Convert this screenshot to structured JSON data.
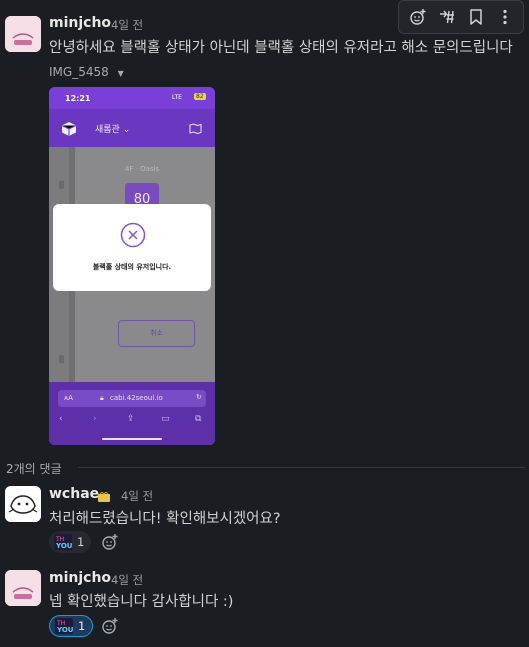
{
  "toolbar": {
    "icons": [
      "add-reaction-icon",
      "reply-in-thread-icon",
      "bookmark-icon",
      "more-actions-icon"
    ]
  },
  "message1": {
    "author": "minjcho",
    "time": "4일 전",
    "text": "안녕하세요 블랙홀 상태가 아닌데 블랙홀 상태의 유저라고 해소 문의드립니다",
    "attachment": {
      "filename": "IMG_5458",
      "phone_status_time": "12:21",
      "phone_status_net": "LTE",
      "phone_status_battery": "82",
      "campus_selector": "새롬관",
      "floor_label": "4F · Oasis",
      "seat_number": "80",
      "dialog_text": "블랙홀 상태의 유저입니다.",
      "cancel_button": "취소",
      "url_aa": "ᴀA",
      "url": "cabi.42seoul.io"
    }
  },
  "thread": {
    "replies_label": "2개의 댓글"
  },
  "message2": {
    "author": "wchae",
    "time": "4일 전",
    "text": "처리해드렸습니다! 확인해보시겠어요?",
    "reaction_count": "1"
  },
  "message3": {
    "author": "minjcho",
    "time": "4일 전",
    "text": "넵 확인했습니다 감사합니다 :)",
    "reaction_count": "1"
  },
  "colors": {
    "background": "#1a1d21",
    "phone_purple": "#7a4bd0",
    "reaction_active_border": "#1d9bd1"
  }
}
